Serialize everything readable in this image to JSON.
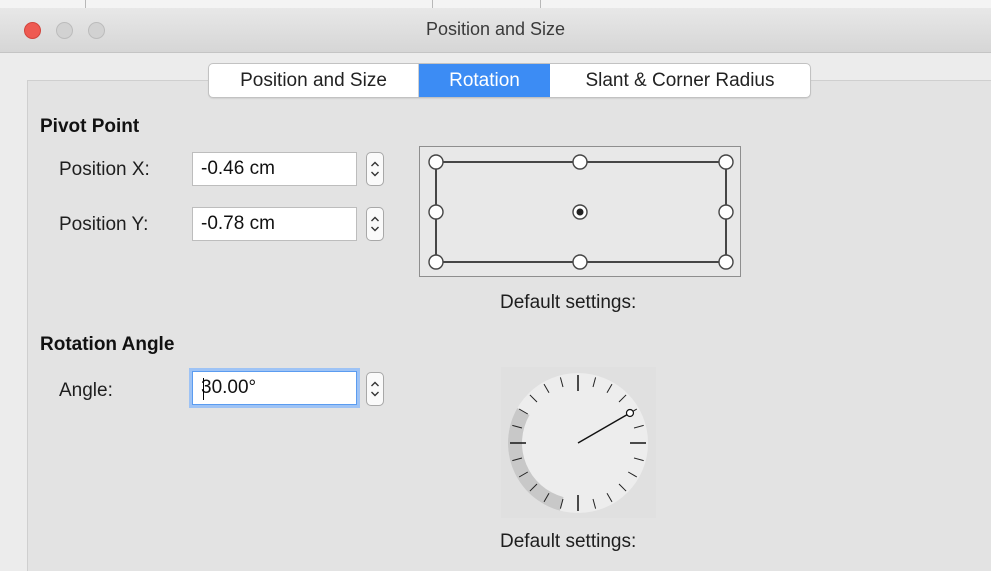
{
  "window": {
    "title": "Position and Size"
  },
  "tabs": [
    {
      "label": "Position and Size",
      "selected": false
    },
    {
      "label": "Rotation",
      "selected": true
    },
    {
      "label": "Slant & Corner Radius",
      "selected": false
    }
  ],
  "pivot_point": {
    "heading": "Pivot Point",
    "position_x": {
      "label": "Position X:",
      "value": "-0.46 cm"
    },
    "position_y": {
      "label": "Position Y:",
      "value": "-0.78 cm"
    },
    "selected_point": "center",
    "caption": "Default settings:"
  },
  "rotation_angle": {
    "heading": "Rotation Angle",
    "angle": {
      "label": "Angle:",
      "value": "30.00°"
    },
    "angle_degrees": 30,
    "caption": "Default settings:"
  },
  "colors": {
    "accent": "#3c8cf4",
    "close_button": "#ee5a52"
  }
}
